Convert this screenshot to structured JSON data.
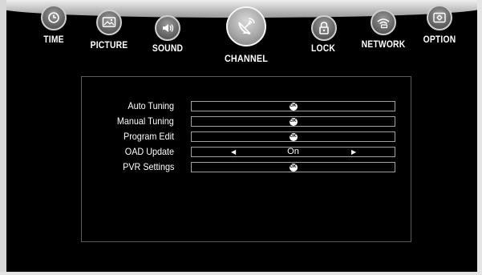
{
  "nav": {
    "tabs": [
      {
        "id": "time",
        "label": "TIME",
        "icon": "clock-icon",
        "active": false
      },
      {
        "id": "picture",
        "label": "PICTURE",
        "icon": "picture-icon",
        "active": false
      },
      {
        "id": "sound",
        "label": "SOUND",
        "icon": "speaker-icon",
        "active": false
      },
      {
        "id": "channel",
        "label": "CHANNEL",
        "icon": "satellite-dish-icon",
        "active": true
      },
      {
        "id": "lock",
        "label": "LOCK",
        "icon": "lock-icon",
        "active": false
      },
      {
        "id": "network",
        "label": "NETWORK",
        "icon": "wifi-icon",
        "active": false
      },
      {
        "id": "option",
        "label": "OPTION",
        "icon": "settings-icon",
        "active": false
      }
    ]
  },
  "menu": {
    "rows": [
      {
        "label": "Auto Tuning",
        "control": "ok",
        "ok": "OK"
      },
      {
        "label": "Manual Tuning",
        "control": "ok",
        "ok": "OK"
      },
      {
        "label": "Program Edit",
        "control": "ok",
        "ok": "OK"
      },
      {
        "label": "OAD Update",
        "control": "select",
        "value": "On"
      },
      {
        "label": "PVR Settings",
        "control": "ok",
        "ok": "OK"
      }
    ]
  }
}
